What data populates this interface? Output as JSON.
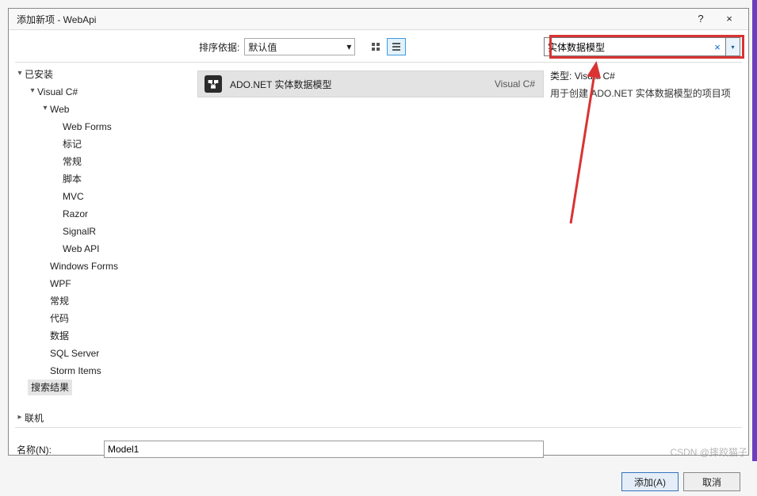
{
  "titlebar": {
    "title": "添加新项 - WebApi",
    "help": "?",
    "close": "×"
  },
  "sort": {
    "label": "排序依据:",
    "value": "默认值",
    "chevron": "▾"
  },
  "search": {
    "value": "实体数据模型",
    "clear": "×",
    "chevron": "▾"
  },
  "tree": {
    "root": "已安装",
    "csharp": "Visual C#",
    "web": "Web",
    "web_children": [
      "Web Forms",
      "标记",
      "常规",
      "脚本",
      "MVC",
      "Razor",
      "SignalR",
      "Web API"
    ],
    "csharp_rest": [
      "Windows Forms",
      "WPF",
      "常规",
      "代码",
      "数据",
      "SQL Server",
      "Storm Items"
    ],
    "search_results": "搜索结果",
    "online": "联机"
  },
  "template": {
    "name": "ADO.NET 实体数据模型",
    "language": "Visual C#"
  },
  "preview": {
    "type_label": "类型:",
    "type_value": "Visual C#",
    "desc": "用于创建 ADO.NET 实体数据模型的项目项"
  },
  "name_field": {
    "label": "名称(N):",
    "value": "Model1"
  },
  "buttons": {
    "add": "添加(A)",
    "cancel": "取消"
  },
  "watermark": "CSDN @摔跤猫子"
}
